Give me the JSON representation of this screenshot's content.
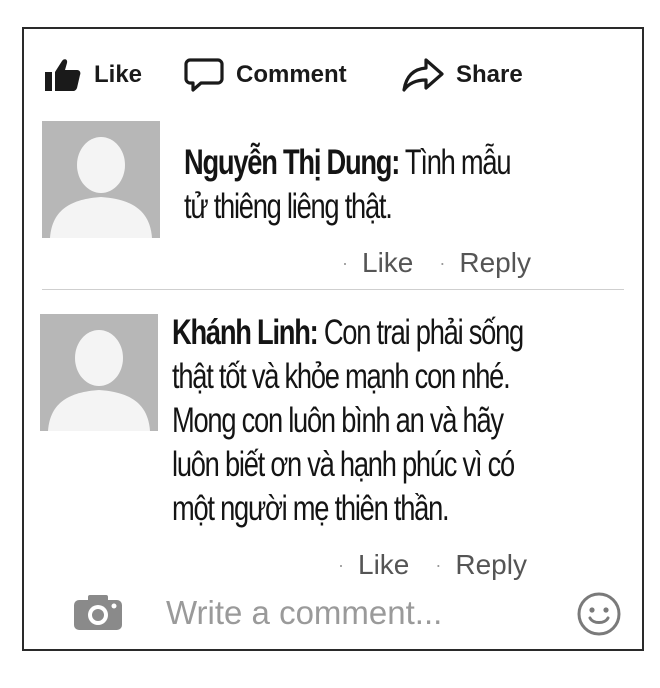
{
  "actions": {
    "like_label": "Like",
    "comment_label": "Comment",
    "share_label": "Share"
  },
  "comments": [
    {
      "author": "Nguyễn Thị Dung:",
      "lines": [
        "Tình mẫu",
        "tử thiêng liêng thật."
      ],
      "like_label": "Like",
      "reply_label": "Reply"
    },
    {
      "author": "Khánh Linh:",
      "lines": [
        "Con trai phải sống",
        "thật tốt và khỏe mạnh con nhé.",
        "Mong con luôn bình an và hãy",
        "luôn biết ơn và hạnh phúc vì có",
        "một người mẹ thiên thần."
      ],
      "like_label": "Like",
      "reply_label": "Reply"
    }
  ],
  "composer": {
    "placeholder": "Write a comment..."
  },
  "icons": {
    "like": "thumbs-up-icon",
    "comment": "speech-bubble-icon",
    "share": "share-arrow-icon",
    "camera": "camera-icon",
    "emoji": "smiley-icon"
  }
}
